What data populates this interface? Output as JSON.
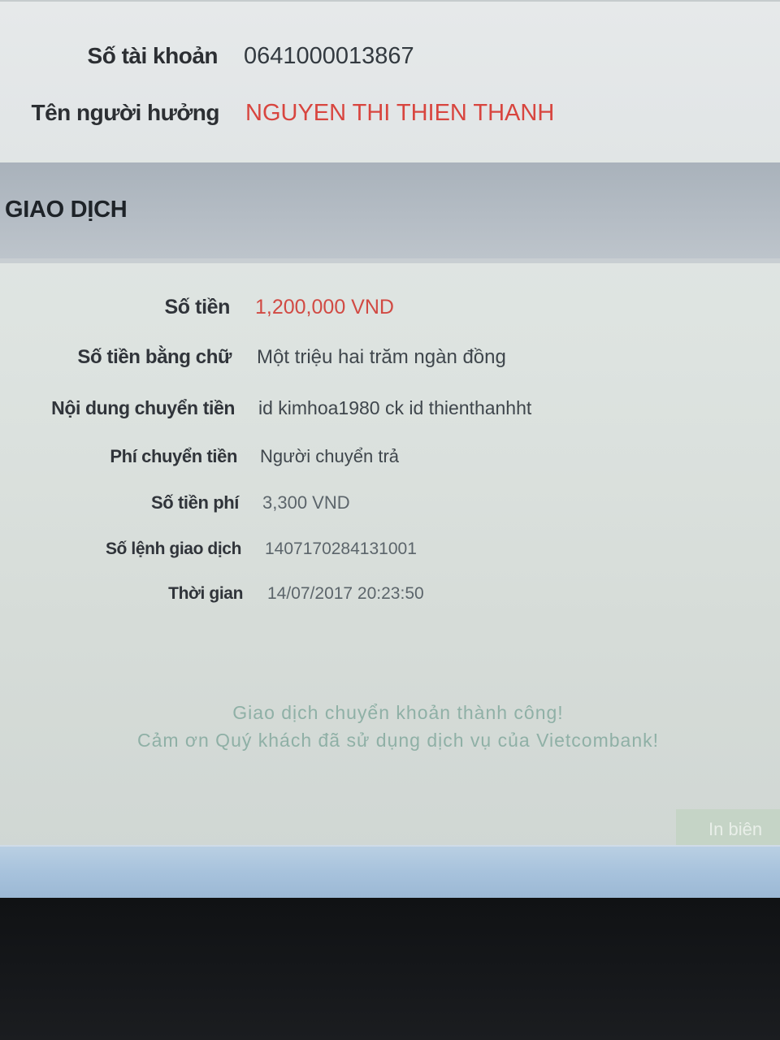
{
  "recipient": {
    "account_number_label": "Số tài khoản",
    "account_number": "0641000013867",
    "beneficiary_name_label": "Tên người hưởng",
    "beneficiary_name": "NGUYEN THI THIEN THANH"
  },
  "transaction": {
    "section_title": "GIAO DỊCH",
    "rows": [
      {
        "label": "Số tiền",
        "value": "1,200,000 VND"
      },
      {
        "label": "Số tiền bằng chữ",
        "value": "Một triệu hai trăm ngàn đồng"
      },
      {
        "label": "Nội dung chuyển tiền",
        "value": "id kimhoa1980 ck id thienthanhht"
      },
      {
        "label": "Phí chuyển tiền",
        "value": "Người chuyển trả"
      },
      {
        "label": "Số tiền phí",
        "value": "3,300 VND"
      },
      {
        "label": "Số lệnh giao dịch",
        "value": "1407170284131001"
      },
      {
        "label": "Thời gian",
        "value": "14/07/2017 20:23:50"
      }
    ]
  },
  "messages": {
    "success": "Giao dịch chuyển khoản thành công!",
    "thanks": "Cảm ơn Quý khách đã sử dụng dịch vụ của Vietcombank!"
  },
  "buttons": {
    "print_label": "In biên"
  },
  "colors": {
    "highlight_red": "#d8453f",
    "section_bar": "#b4bcc4",
    "message_text": "#8fb0a6"
  }
}
